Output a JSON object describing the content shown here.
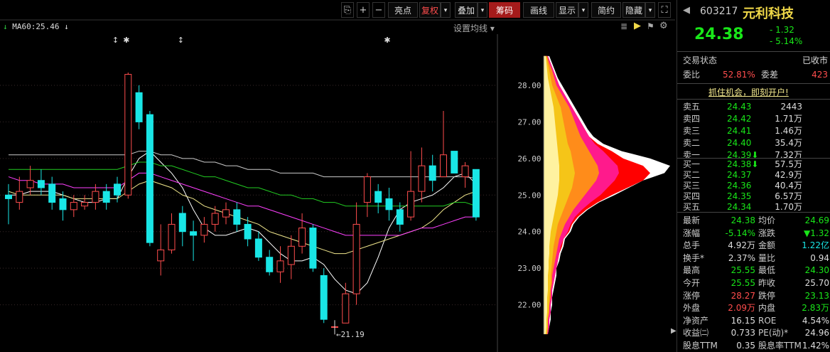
{
  "toolbar": {
    "zoom_plus": "+",
    "zoom_minus": "−",
    "buttons": [
      "亮点",
      "复权",
      "叠加",
      "筹码",
      "画线",
      "显示",
      "简约",
      "隐藏"
    ],
    "restore_dd": "▾",
    "overlay_dd": "▾",
    "display_dd": "▾",
    "hide_dd": "▾"
  },
  "ma_label": "MA60:25.46",
  "ma_settings": "设置均线",
  "chart_data": {
    "type": "candlestick",
    "title": "",
    "y_ticks": [
      "28.00",
      "27.00",
      "26.00",
      "25.00",
      "24.00",
      "23.00",
      "22.00"
    ],
    "y_range": [
      21.0,
      29.4
    ],
    "low_annotation": "21.19",
    "candles": [
      {
        "o": 25.0,
        "c": 24.9,
        "h": 25.3,
        "l": 24.2
      },
      {
        "o": 24.8,
        "c": 25.1,
        "h": 25.5,
        "l": 24.6
      },
      {
        "o": 25.2,
        "c": 25.4,
        "h": 25.8,
        "l": 25.0
      },
      {
        "o": 25.4,
        "c": 25.2,
        "h": 25.7,
        "l": 25.0
      },
      {
        "o": 25.3,
        "c": 24.8,
        "h": 25.5,
        "l": 24.6
      },
      {
        "o": 24.9,
        "c": 24.6,
        "h": 25.1,
        "l": 24.3
      },
      {
        "o": 24.6,
        "c": 24.8,
        "h": 25.0,
        "l": 24.4
      },
      {
        "o": 24.7,
        "c": 24.8,
        "h": 25.0,
        "l": 24.6
      },
      {
        "o": 24.8,
        "c": 25.1,
        "h": 25.3,
        "l": 24.6
      },
      {
        "o": 25.1,
        "c": 24.8,
        "h": 25.3,
        "l": 24.6
      },
      {
        "o": 25.3,
        "c": 25.0,
        "h": 25.5,
        "l": 24.8
      },
      {
        "o": 25.0,
        "c": 28.3,
        "h": 28.35,
        "l": 24.9
      },
      {
        "o": 27.8,
        "c": 27.0,
        "h": 28.0,
        "l": 26.8
      },
      {
        "o": 27.2,
        "c": 23.7,
        "h": 27.3,
        "l": 23.6
      },
      {
        "o": 23.2,
        "c": 23.5,
        "h": 24.2,
        "l": 22.8
      },
      {
        "o": 23.5,
        "c": 24.2,
        "h": 24.5,
        "l": 23.4
      },
      {
        "o": 24.5,
        "c": 24.0,
        "h": 24.7,
        "l": 23.6
      },
      {
        "o": 24.0,
        "c": 23.9,
        "h": 24.3,
        "l": 23.2
      },
      {
        "o": 23.9,
        "c": 24.2,
        "h": 24.4,
        "l": 23.7
      },
      {
        "o": 24.2,
        "c": 24.5,
        "h": 24.7,
        "l": 24.0
      },
      {
        "o": 24.4,
        "c": 24.6,
        "h": 24.8,
        "l": 24.2
      },
      {
        "o": 24.6,
        "c": 24.2,
        "h": 24.8,
        "l": 24.0
      },
      {
        "o": 24.2,
        "c": 23.8,
        "h": 24.4,
        "l": 23.6
      },
      {
        "o": 23.8,
        "c": 23.3,
        "h": 24.0,
        "l": 23.2
      },
      {
        "o": 23.3,
        "c": 22.9,
        "h": 23.5,
        "l": 22.8
      },
      {
        "o": 22.9,
        "c": 23.2,
        "h": 23.6,
        "l": 22.6
      },
      {
        "o": 23.1,
        "c": 23.6,
        "h": 23.9,
        "l": 22.7
      },
      {
        "o": 23.6,
        "c": 24.1,
        "h": 24.5,
        "l": 23.4
      },
      {
        "o": 24.1,
        "c": 23.0,
        "h": 24.2,
        "l": 22.9
      },
      {
        "o": 22.8,
        "c": 21.6,
        "h": 23.0,
        "l": 21.5
      },
      {
        "o": 21.4,
        "c": 21.4,
        "h": 21.4,
        "l": 21.19
      },
      {
        "o": 21.5,
        "c": 22.3,
        "h": 22.6,
        "l": 21.5
      },
      {
        "o": 22.3,
        "c": 24.2,
        "h": 24.8,
        "l": 22.0
      },
      {
        "o": 24.8,
        "c": 25.5,
        "h": 25.6,
        "l": 24.4
      },
      {
        "o": 25.1,
        "c": 24.8,
        "h": 25.3,
        "l": 24.5
      },
      {
        "o": 24.9,
        "c": 24.6,
        "h": 25.2,
        "l": 24.3
      },
      {
        "o": 24.6,
        "c": 24.2,
        "h": 24.8,
        "l": 24.0
      },
      {
        "o": 24.4,
        "c": 25.1,
        "h": 26.2,
        "l": 24.3
      },
      {
        "o": 25.1,
        "c": 25.8,
        "h": 26.3,
        "l": 24.8
      },
      {
        "o": 25.8,
        "c": 25.4,
        "h": 26.1,
        "l": 25.1
      },
      {
        "o": 25.5,
        "c": 26.1,
        "h": 27.3,
        "l": 25.5
      },
      {
        "o": 26.2,
        "c": 25.6,
        "h": 26.1,
        "l": 25.6
      },
      {
        "o": 25.5,
        "c": 25.8,
        "h": 25.9,
        "l": 25.2
      },
      {
        "o": 25.7,
        "c": 24.4,
        "h": 25.7,
        "l": 24.3
      }
    ],
    "ma_series": [
      {
        "color": "#ffffff",
        "values": [
          25.0,
          25.0,
          25.1,
          25.1,
          25.1,
          25.0,
          24.9,
          24.8,
          24.8,
          24.9,
          24.9,
          25.5,
          26.0,
          26.2,
          25.9,
          25.6,
          25.2,
          24.6,
          24.1,
          23.9,
          23.9,
          24.0,
          24.1,
          24.0,
          23.7,
          23.4,
          23.2,
          23.2,
          23.3,
          23.1,
          22.7,
          22.4,
          22.3,
          22.6,
          23.3,
          24.1,
          24.6,
          24.8,
          24.9,
          25.0,
          25.2,
          25.5,
          25.6,
          25.3
        ]
      },
      {
        "color": "#f0e68c",
        "values": [
          25.1,
          25.0,
          25.0,
          25.0,
          25.0,
          25.0,
          24.9,
          24.9,
          24.9,
          24.9,
          24.9,
          25.1,
          25.3,
          25.4,
          25.3,
          25.2,
          25.0,
          24.9,
          24.7,
          24.6,
          24.5,
          24.4,
          24.3,
          24.2,
          24.0,
          23.9,
          23.8,
          23.7,
          23.6,
          23.5,
          23.4,
          23.4,
          23.5,
          23.6,
          23.7,
          23.8,
          23.9,
          24.0,
          24.1,
          24.3,
          24.6,
          24.8,
          25.0,
          25.1
        ]
      },
      {
        "color": "#ff40ff",
        "values": [
          25.5,
          25.4,
          25.4,
          25.3,
          25.3,
          25.3,
          25.2,
          25.2,
          25.2,
          25.2,
          25.2,
          25.4,
          25.6,
          25.6,
          25.5,
          25.4,
          25.3,
          25.2,
          25.1,
          25.0,
          24.9,
          24.8,
          24.7,
          24.7,
          24.6,
          24.5,
          24.4,
          24.3,
          24.2,
          24.1,
          24.0,
          23.9,
          23.9,
          23.9,
          23.9,
          23.9,
          23.9,
          24.0,
          24.1,
          24.1,
          24.2,
          24.3,
          24.4,
          24.4
        ]
      },
      {
        "color": "#22cc22",
        "values": [
          25.7,
          25.7,
          25.7,
          25.7,
          25.7,
          25.7,
          25.7,
          25.7,
          25.7,
          25.7,
          25.7,
          25.8,
          25.9,
          25.9,
          25.8,
          25.8,
          25.7,
          25.6,
          25.5,
          25.5,
          25.4,
          25.3,
          25.2,
          25.2,
          25.1,
          25.0,
          25.0,
          24.9,
          24.9,
          24.8,
          24.8,
          24.7,
          24.7,
          24.7,
          24.7,
          24.7,
          24.7,
          24.7,
          24.7,
          24.7,
          24.7,
          24.8,
          24.8,
          24.7
        ]
      },
      {
        "color": "#cccccc",
        "values": [
          26.1,
          26.1,
          26.1,
          26.1,
          26.1,
          26.1,
          26.1,
          26.1,
          26.1,
          26.1,
          26.1,
          26.1,
          26.2,
          26.2,
          26.1,
          26.1,
          26.0,
          26.0,
          25.9,
          25.9,
          25.8,
          25.8,
          25.7,
          25.7,
          25.7,
          25.6,
          25.6,
          25.6,
          25.6,
          25.5,
          25.5,
          25.5,
          25.5,
          25.5,
          25.5,
          25.5,
          25.5,
          25.5,
          25.5,
          25.5,
          25.5,
          25.5,
          25.5,
          25.46
        ]
      }
    ],
    "markers": [
      {
        "index": 5,
        "symbol": "↕"
      },
      {
        "index": 6,
        "symbol": "✱"
      },
      {
        "index": 11,
        "symbol": "↕"
      },
      {
        "index": 30,
        "symbol": "✱"
      }
    ],
    "chip_profile": {
      "bins": [
        28.8,
        28.6,
        28.4,
        28.2,
        28.0,
        27.8,
        27.6,
        27.4,
        27.2,
        27.0,
        26.8,
        26.6,
        26.4,
        26.2,
        26.0,
        25.8,
        25.6,
        25.4,
        25.2,
        25.0,
        24.8,
        24.6,
        24.4,
        24.2,
        24.0,
        23.8,
        23.6,
        23.4,
        23.2,
        23.0,
        22.8,
        22.6,
        22.4,
        22.2,
        22.0,
        21.8,
        21.6,
        21.4,
        21.2
      ],
      "layers": [
        {
          "color": "#ffffff",
          "values": [
            8,
            12,
            16,
            20,
            26,
            32,
            38,
            44,
            50,
            56,
            62,
            70,
            84,
            110,
            150,
            178,
            170,
            140,
            120,
            100,
            78,
            62,
            50,
            42,
            38,
            30,
            28,
            24,
            22,
            18,
            18,
            16,
            14,
            12,
            12,
            10,
            10,
            8,
            6
          ]
        },
        {
          "color": "#ff0000",
          "values": [
            6,
            10,
            14,
            18,
            22,
            28,
            34,
            40,
            46,
            52,
            58,
            64,
            76,
            96,
            112,
            140,
            150,
            140,
            118,
            96,
            76,
            60,
            48,
            40,
            36,
            28,
            26,
            22,
            20,
            18,
            16,
            14,
            12,
            12,
            10,
            10,
            8,
            8,
            6
          ]
        },
        {
          "color": "#ff1a8c",
          "values": [
            6,
            10,
            14,
            18,
            22,
            28,
            34,
            40,
            46,
            52,
            58,
            64,
            72,
            84,
            94,
            104,
            106,
            100,
            90,
            80,
            66,
            54,
            44,
            38,
            34,
            28,
            24,
            22,
            20,
            18,
            16,
            14,
            12,
            12,
            10,
            10,
            8,
            8,
            6
          ]
        },
        {
          "color": "#ff8c1a",
          "values": [
            5,
            8,
            12,
            15,
            18,
            24,
            30,
            36,
            40,
            44,
            48,
            52,
            58,
            64,
            70,
            76,
            78,
            74,
            66,
            58,
            50,
            42,
            36,
            30,
            26,
            22,
            20,
            18,
            16,
            14,
            12,
            12,
            10,
            10,
            8,
            8,
            6,
            6,
            5
          ]
        },
        {
          "color": "#f5c518",
          "values": [
            4,
            6,
            8,
            10,
            12,
            16,
            20,
            24,
            26,
            28,
            30,
            32,
            34,
            38,
            40,
            42,
            44,
            42,
            40,
            36,
            32,
            28,
            24,
            20,
            18,
            16,
            14,
            13,
            12,
            11,
            10,
            10,
            9,
            8,
            8,
            7,
            6,
            6,
            5
          ]
        },
        {
          "color": "#fff2a0",
          "values": [
            3,
            4,
            5,
            6,
            8,
            10,
            12,
            14,
            15,
            16,
            17,
            18,
            19,
            20,
            21,
            22,
            22,
            22,
            21,
            20,
            18,
            16,
            14,
            12,
            10,
            9,
            8,
            8,
            7,
            7,
            6,
            6,
            6,
            5,
            5,
            5,
            4,
            4,
            3
          ]
        }
      ]
    }
  },
  "quote": {
    "code": "603217",
    "name": "元利科技",
    "price": "24.38",
    "change": "- 1.32",
    "change_pct": "- 5.14%",
    "status_label": "交易状态",
    "status_value": "已收市",
    "weibi_label": "委比",
    "weibi_value": "52.81%",
    "weicha_label": "委差",
    "weicha_value": "423",
    "promo": "抓住机会，即刻开户!",
    "asks": [
      {
        "label": "卖五",
        "price": "24.43",
        "vol": "2443"
      },
      {
        "label": "卖四",
        "price": "24.42",
        "vol": "1.71万"
      },
      {
        "label": "卖三",
        "price": "24.41",
        "vol": "1.46万"
      },
      {
        "label": "卖二",
        "price": "24.40",
        "vol": "35.4万"
      },
      {
        "label": "卖一",
        "price": "24.39⬇",
        "vol": "7.32万"
      }
    ],
    "bids": [
      {
        "label": "买一",
        "price": "24.38⬇",
        "vol": "57.5万"
      },
      {
        "label": "买二",
        "price": "24.37",
        "vol": "42.9万"
      },
      {
        "label": "买三",
        "price": "24.36",
        "vol": "40.4万"
      },
      {
        "label": "买四",
        "price": "24.35",
        "vol": "6.57万"
      },
      {
        "label": "买五",
        "price": "24.34",
        "vol": "1.70万"
      }
    ],
    "stats": [
      {
        "l1": "最新",
        "v1": "24.38",
        "c1": "green",
        "l2": "均价",
        "v2": "24.69",
        "c2": "green"
      },
      {
        "l1": "涨幅",
        "v1": "-5.14%",
        "c1": "green",
        "l2": "涨跌",
        "v2": "▼1.32",
        "c2": "green"
      },
      {
        "l1": "总手",
        "v1": "4.92万",
        "c1": "white",
        "l2": "金额",
        "v2": "1.22亿",
        "c2": "cyan"
      },
      {
        "l1": "换手*",
        "v1": "2.37%",
        "c1": "white",
        "l2": "量比",
        "v2": "0.94",
        "c2": "white"
      },
      {
        "l1": "最高",
        "v1": "25.55",
        "c1": "green",
        "l2": "最低",
        "v2": "24.30",
        "c2": "green"
      },
      {
        "l1": "今开",
        "v1": "25.55",
        "c1": "green",
        "l2": "昨收",
        "v2": "25.70",
        "c2": "white"
      },
      {
        "l1": "涨停",
        "v1": "28.27",
        "c1": "red",
        "l2": "跌停",
        "v2": "23.13",
        "c2": "green"
      },
      {
        "l1": "外盘",
        "v1": "2.09万",
        "c1": "red",
        "l2": "内盘",
        "v2": "2.83万",
        "c2": "green"
      },
      {
        "l1": "净资产",
        "v1": "16.15",
        "c1": "white",
        "l2": "ROE",
        "v2": "4.54%",
        "c2": "white"
      },
      {
        "l1": "收益㈡",
        "v1": "0.733",
        "c1": "white",
        "l2": "PE(动)*",
        "v2": "24.96",
        "c2": "white"
      },
      {
        "l1": "股息TTM",
        "v1": "0.35",
        "c1": "white",
        "l2": "股息率TTM",
        "v2": "1.42%",
        "c2": "white"
      }
    ]
  }
}
